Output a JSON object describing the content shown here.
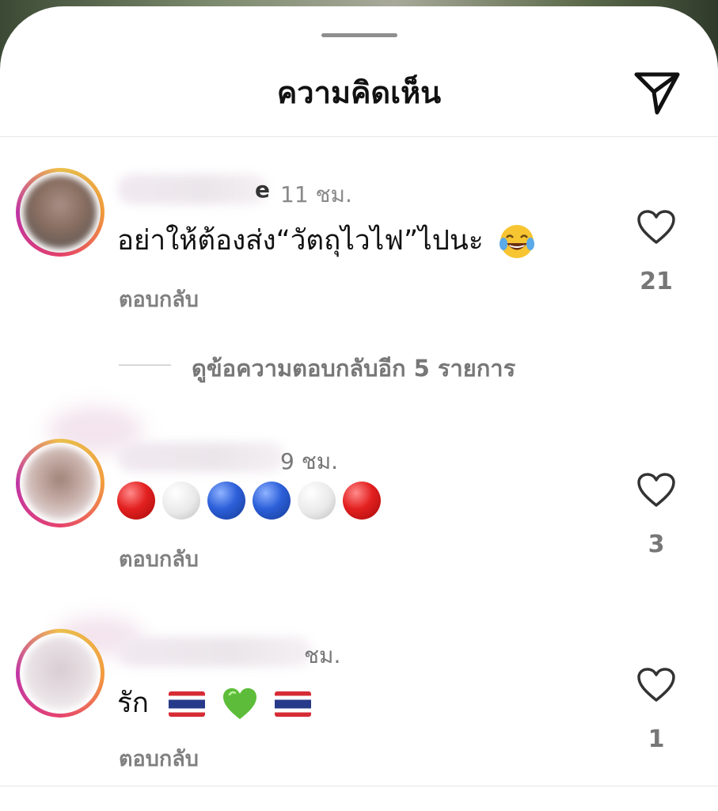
{
  "header": {
    "title": "ความคิดเห็น",
    "send_icon": "send-icon"
  },
  "comments": [
    {
      "username_visible_tail": "e",
      "time": "11 ชม.",
      "text": "อย่าให้ต้องส่ง“วัตถุไวไฟ”ไปนะ",
      "emoji": "face-with-tears-of-joy",
      "reply_label": "ตอบกลับ",
      "likes": "21",
      "view_replies": "ดูข้อความตอบกลับอีก 5 รายการ"
    },
    {
      "time": "9 ชม.",
      "emoji_sequence": [
        "red",
        "white",
        "blue",
        "blue",
        "white",
        "red"
      ],
      "reply_label": "ตอบกลับ",
      "likes": "3"
    },
    {
      "time": "ชม.",
      "text": "รัก",
      "emoji": [
        "thailand-flag",
        "green-heart",
        "thailand-flag"
      ],
      "reply_label": "ตอบกลับ",
      "likes": "1"
    }
  ],
  "colors": {
    "background": "#ffffff",
    "text": "#111111",
    "secondary_text": "#808080",
    "divider": "#e6e6e6"
  }
}
